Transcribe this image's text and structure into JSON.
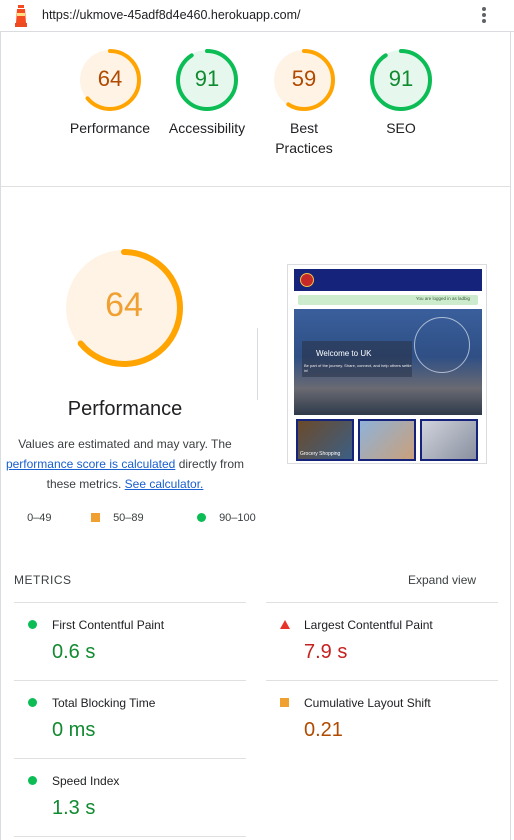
{
  "browser": {
    "url": "https://ukmove-45adf8d4e460.herokuapp.com/"
  },
  "colors": {
    "pass": "#0cbd55",
    "average": "#ffa400",
    "fail": "#ff4e42",
    "link": "#1a5fd0"
  },
  "summary_gauges": [
    {
      "label": "Performance",
      "score": "64",
      "rating": "average"
    },
    {
      "label": "Accessibility",
      "score": "91",
      "rating": "pass"
    },
    {
      "label_line1": "Best",
      "label_line2": "Practices",
      "score": "59",
      "rating": "average"
    },
    {
      "label": "SEO",
      "score": "91",
      "rating": "pass"
    }
  ],
  "performance": {
    "score": "64",
    "title": "Performance",
    "desc_1": "Values are estimated and may vary. The",
    "link_1": "performance score is calculated",
    "desc_2": "directly from",
    "desc_3": "these metrics.",
    "link_2": "See calculator.",
    "legend": {
      "fail": "0–49",
      "average": "50–89",
      "pass": "90–100"
    }
  },
  "thumbnail": {
    "alert": "You are logged in as ladbig",
    "hero_title": "Welcome to UK",
    "hero_subtitle": "Be part of the journey. Share, connect, and help others settle in!",
    "card_1": "Grocery Shopping"
  },
  "metrics": {
    "heading": "METRICS",
    "expand": "Expand view",
    "items": [
      {
        "title": "First Contentful Paint",
        "value": "0.6 s",
        "rating": "pass"
      },
      {
        "title": "Largest Contentful Paint",
        "value": "7.9 s",
        "rating": "fail"
      },
      {
        "title": "Total Blocking Time",
        "value": "0 ms",
        "rating": "pass"
      },
      {
        "title": "Cumulative Layout Shift",
        "value": "0.21",
        "rating": "average"
      },
      {
        "title": "Speed Index",
        "value": "1.3 s",
        "rating": "pass"
      }
    ]
  }
}
